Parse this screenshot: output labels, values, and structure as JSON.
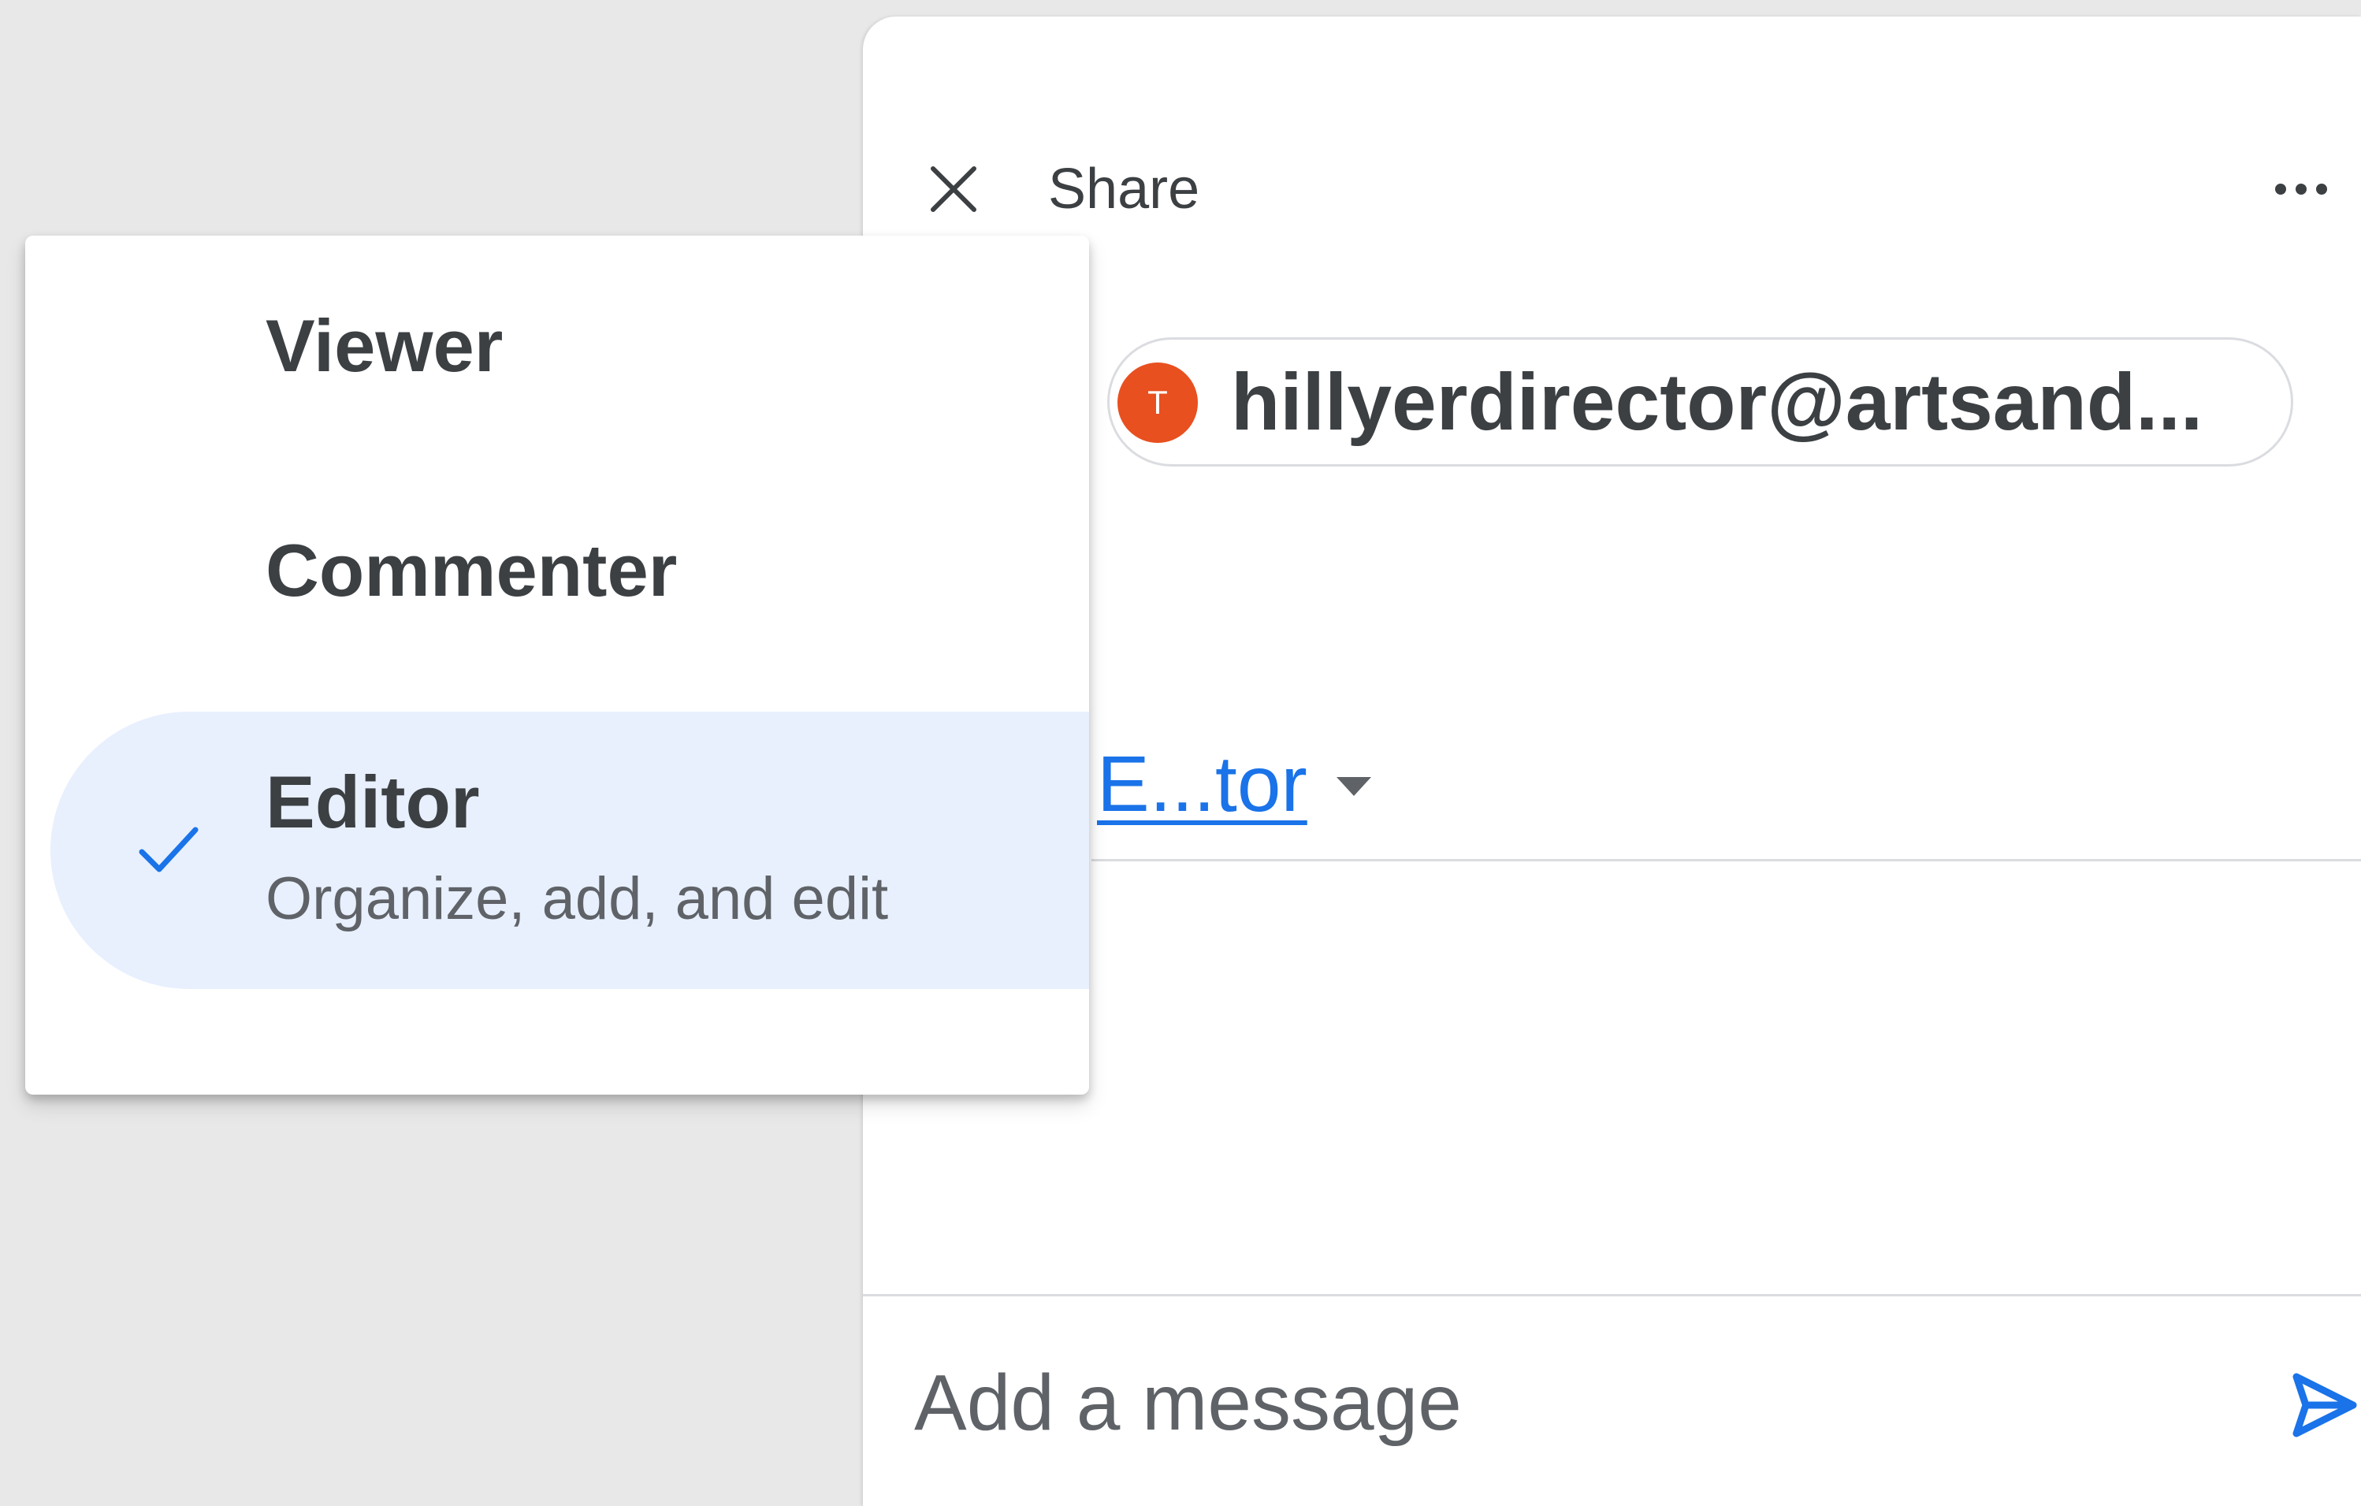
{
  "share_panel": {
    "title": "Share",
    "close_icon": "close-icon",
    "more_icon": "more-horizontal-icon",
    "recipient": {
      "avatar_initial": "T",
      "avatar_color": "#e8501f",
      "email": "hillyerdirector@artsand..."
    },
    "role_selector": {
      "label": "E...tor",
      "caret_icon": "caret-down-icon"
    },
    "message": {
      "placeholder": "Add a message",
      "value": ""
    },
    "send_icon": "send-icon"
  },
  "role_menu": {
    "items": [
      {
        "label": "Viewer",
        "selected": false
      },
      {
        "label": "Commenter",
        "selected": false
      },
      {
        "label": "Editor",
        "description": "Organize, add, and edit",
        "selected": true
      }
    ],
    "check_icon": "check-icon",
    "highlight_color": "#e8f0fe"
  },
  "colors": {
    "accent": "#1a73e8",
    "text_primary": "#3c4043",
    "text_secondary": "#5f6368",
    "background": "#e8e8e8"
  }
}
